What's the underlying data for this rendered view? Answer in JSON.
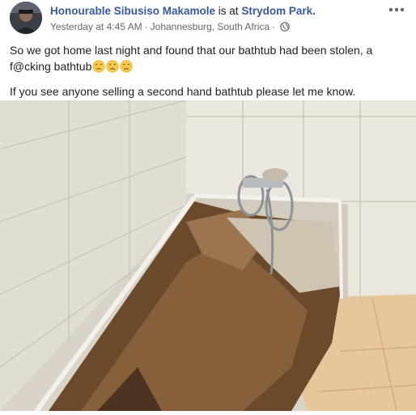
{
  "post": {
    "author": "Honourable Sibusiso Makamole",
    "checkin_text": " is at ",
    "place": "Strydom Park.",
    "timestamp": "Yesterday at 4:45 AM",
    "separator": "·",
    "location": "Johannesburg, South Africa",
    "privacy_separator": "·",
    "text_line1": "So we got home last night and found that our bathtub had been stolen, a f@cking bathtub",
    "text_line2": "If you see anyone selling a second hand bathtub please let me know.",
    "emojis": [
      "sad-but-relieved-face",
      "sad-but-relieved-face",
      "sad-but-relieved-face"
    ],
    "photo_subject": "Tiled bathroom corner with the bathtub removed, exposing bare dirt and a pipe"
  },
  "icons": {
    "more": "more-options-icon",
    "privacy": "globe-icon"
  },
  "colors": {
    "link": "#385898",
    "meta": "#616770",
    "text": "#1c1e21"
  }
}
